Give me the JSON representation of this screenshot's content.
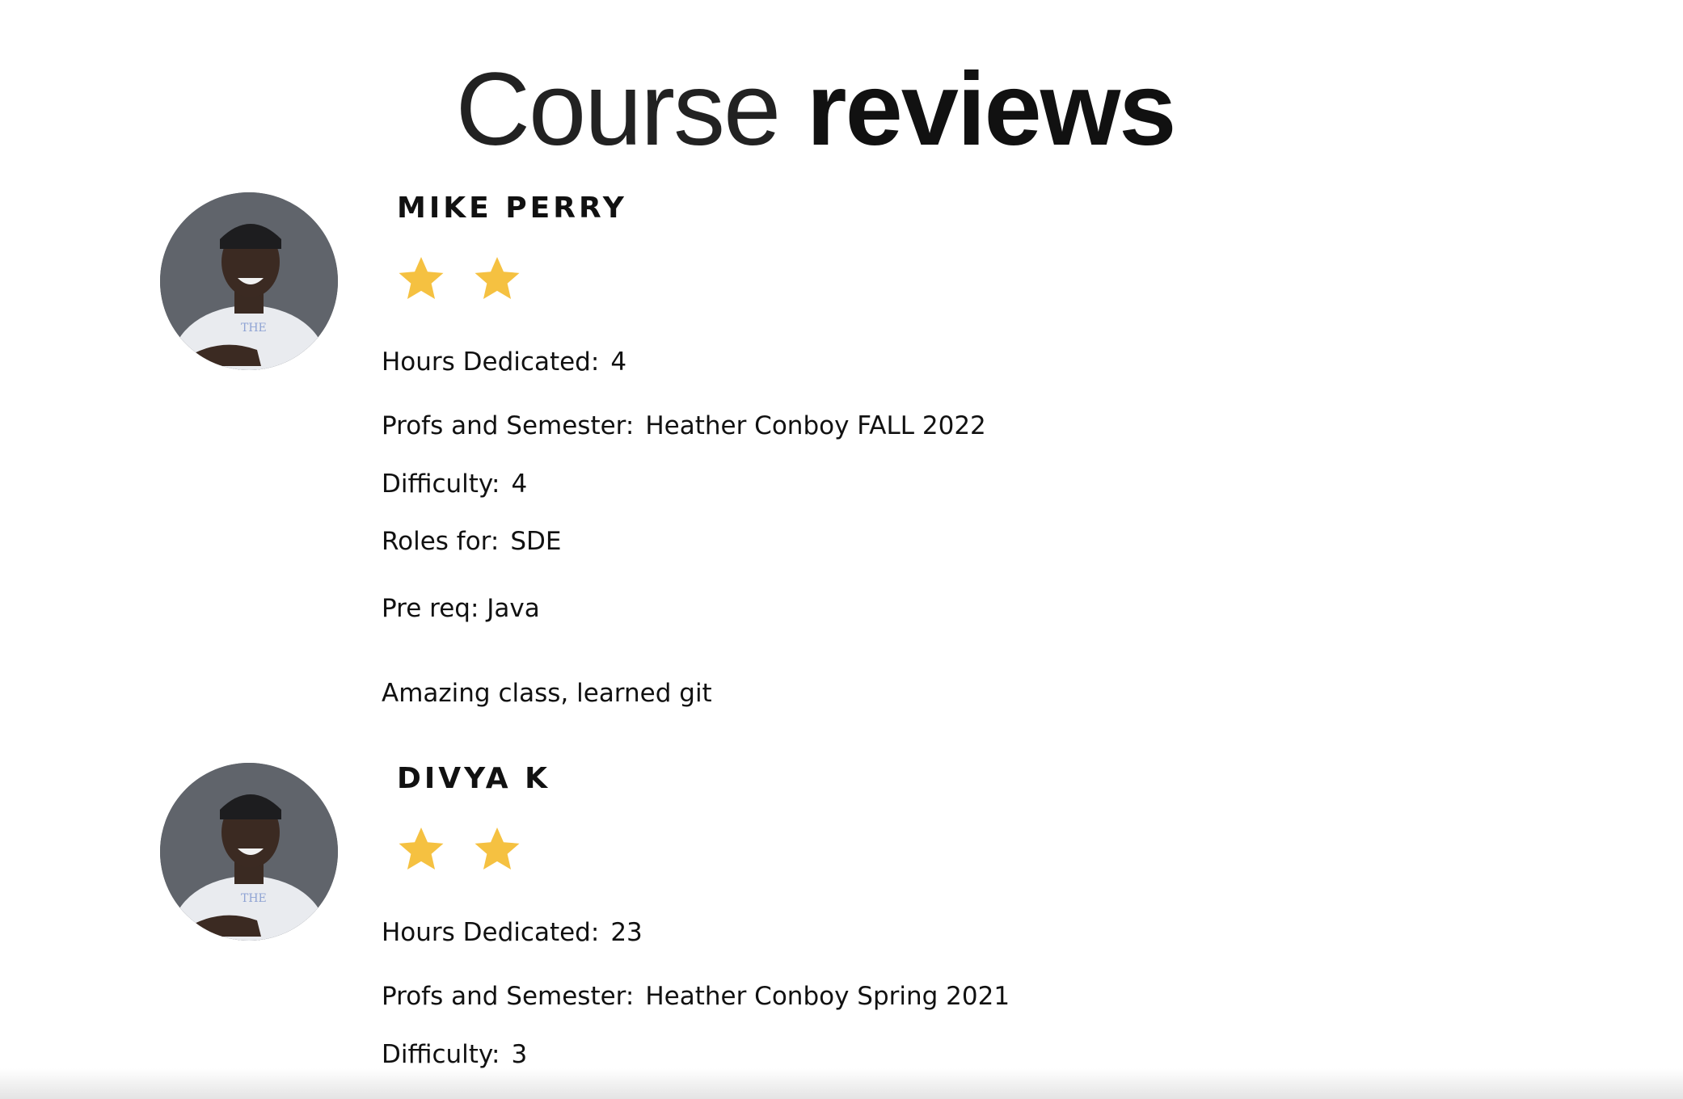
{
  "header": {
    "title_light": "Course",
    "title_bold": "reviews"
  },
  "colors": {
    "star": "#F5C141",
    "text": "#111111"
  },
  "reviews": [
    {
      "name": "MIKE PERRY",
      "rating": 2,
      "hours_label": "Hours Dedicated:",
      "hours_value": "4",
      "profs_label": "Profs and Semester:",
      "profs_value": "Heather Conboy FALL 2022",
      "difficulty_label": "Difficulty:",
      "difficulty_value": "4",
      "roles_label": "Roles for:",
      "roles_value": "SDE",
      "prereq": "Pre req: Java",
      "comment": "Amazing class, learned git"
    },
    {
      "name": "DIVYA K",
      "rating": 2,
      "hours_label": "Hours Dedicated:",
      "hours_value": "23",
      "profs_label": "Profs and Semester:",
      "profs_value": "Heather Conboy Spring 2021",
      "difficulty_label": "Difficulty:",
      "difficulty_value": "3"
    }
  ]
}
